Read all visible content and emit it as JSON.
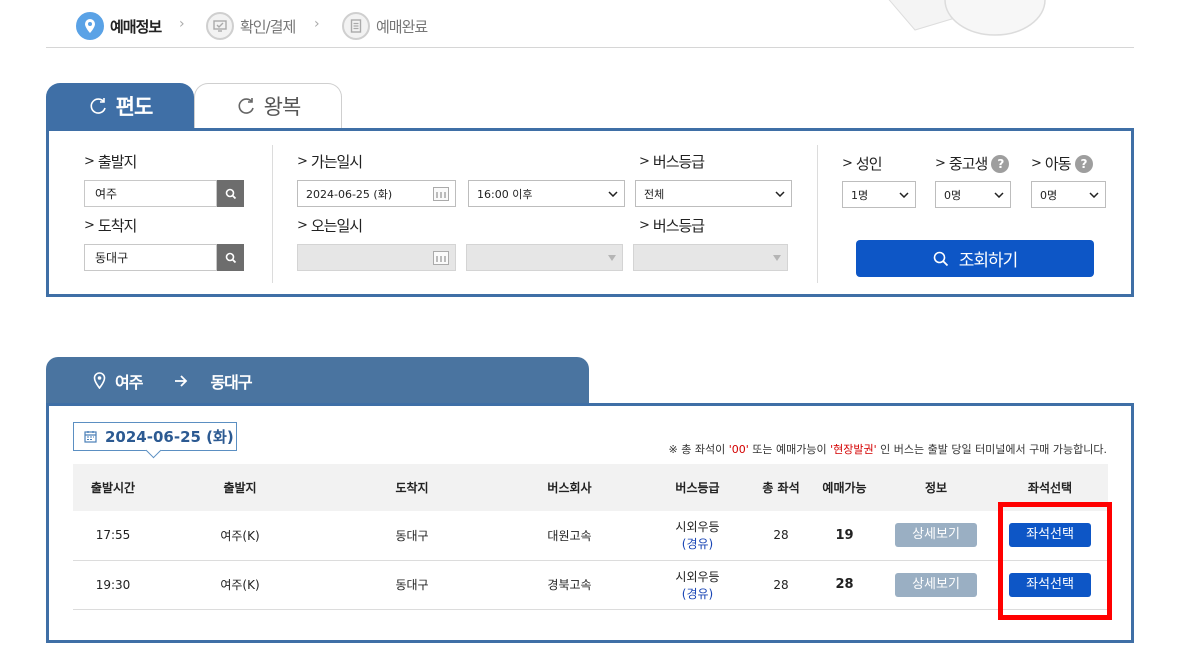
{
  "steps": [
    {
      "label": "예매정보",
      "active": true
    },
    {
      "label": "확인/결제",
      "active": false
    },
    {
      "label": "예매완료",
      "active": false
    }
  ],
  "trip_tabs": {
    "oneway": "편도",
    "round": "왕복"
  },
  "search": {
    "departure_label": "출발지",
    "departure_value": "여주",
    "arrival_label": "도착지",
    "arrival_value": "동대구",
    "go_date_label": "가는일시",
    "go_date_value": "2024-06-25 (화)",
    "go_time_value": "16:00 이후",
    "go_grade_label": "버스등급",
    "go_grade_value": "전체",
    "return_date_label": "오는일시",
    "return_grade_label": "버스등급",
    "adult_label": "성인",
    "adult_value": "1명",
    "student_label": "중고생",
    "student_value": "0명",
    "child_label": "아동",
    "child_value": "0명",
    "query_button": "조회하기"
  },
  "route": {
    "from": "여주",
    "to": "동대구"
  },
  "results": {
    "date": "2024-06-25 (화)",
    "note_prefix": "※ 총 좌석이 ",
    "note_zero": "'00'",
    "note_mid": " 또는 예매가능이 ",
    "note_onsite": "'현장발권'",
    "note_suffix": " 인 버스는 출발 당일 터미널에서 구매 가능합니다.",
    "columns": [
      "출발시간",
      "출발지",
      "도착지",
      "버스회사",
      "버스등급",
      "총 좌석",
      "예매가능",
      "정보",
      "좌석선택"
    ],
    "rows": [
      {
        "time": "17:55",
        "from": "여주(K)",
        "to": "동대구",
        "company": "대원고속",
        "grade": "시외우등",
        "grade_sub": "(경유)",
        "total": "28",
        "available": "19",
        "detail": "상세보기",
        "seat": "좌석선택"
      },
      {
        "time": "19:30",
        "from": "여주(K)",
        "to": "동대구",
        "company": "경북고속",
        "grade": "시외우등",
        "grade_sub": "(경유)",
        "total": "28",
        "available": "28",
        "detail": "상세보기",
        "seat": "좌석선택"
      }
    ]
  },
  "colors": {
    "primary": "#3f6fa6",
    "button": "#0d56c6",
    "highlight": "#ff0000"
  }
}
